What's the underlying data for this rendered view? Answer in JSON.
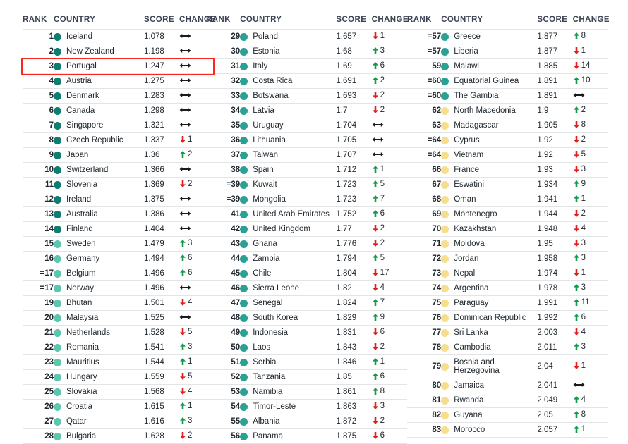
{
  "headers": {
    "rank": "RANK",
    "country": "COUNTRY",
    "score": "SCORE",
    "change": "CHANGE"
  },
  "colors": {
    "dot_dark_teal": "#0f7d72",
    "dot_mid_teal": "#2aa193",
    "dot_light_teal": "#5ec6ae",
    "dot_yellow": "#f7dd8e",
    "up_green": "#159a4b",
    "down_red": "#e02020",
    "flat_black": "#1a1a1a",
    "highlight_border": "#f8281e",
    "row_border": "#e2e4e6",
    "header_text": "#3c4352"
  },
  "highlight": {
    "column": 0,
    "row_rank": "3",
    "country": "Portugal"
  },
  "columns": [
    {
      "id": "column-1",
      "rows": [
        {
          "rank": "1",
          "country": "Iceland",
          "score": "1.078",
          "change": "0",
          "dot": "dot_dark_teal"
        },
        {
          "rank": "2",
          "country": "New Zealand",
          "score": "1.198",
          "change": "0",
          "dot": "dot_dark_teal"
        },
        {
          "rank": "3",
          "country": "Portugal",
          "score": "1.247",
          "change": "0",
          "dot": "dot_dark_teal"
        },
        {
          "rank": "4",
          "country": "Austria",
          "score": "1.275",
          "change": "0",
          "dot": "dot_dark_teal"
        },
        {
          "rank": "5",
          "country": "Denmark",
          "score": "1.283",
          "change": "0",
          "dot": "dot_dark_teal"
        },
        {
          "rank": "6",
          "country": "Canada",
          "score": "1.298",
          "change": "0",
          "dot": "dot_dark_teal"
        },
        {
          "rank": "7",
          "country": "Singapore",
          "score": "1.321",
          "change": "0",
          "dot": "dot_dark_teal"
        },
        {
          "rank": "8",
          "country": "Czech Republic",
          "score": "1.337",
          "change": "-1",
          "dot": "dot_dark_teal"
        },
        {
          "rank": "9",
          "country": "Japan",
          "score": "1.36",
          "change": "+2",
          "dot": "dot_dark_teal"
        },
        {
          "rank": "10",
          "country": "Switzerland",
          "score": "1.366",
          "change": "0",
          "dot": "dot_dark_teal"
        },
        {
          "rank": "11",
          "country": "Slovenia",
          "score": "1.369",
          "change": "-2",
          "dot": "dot_dark_teal"
        },
        {
          "rank": "12",
          "country": "Ireland",
          "score": "1.375",
          "change": "0",
          "dot": "dot_dark_teal"
        },
        {
          "rank": "13",
          "country": "Australia",
          "score": "1.386",
          "change": "0",
          "dot": "dot_dark_teal"
        },
        {
          "rank": "14",
          "country": "Finland",
          "score": "1.404",
          "change": "0",
          "dot": "dot_dark_teal"
        },
        {
          "rank": "15",
          "country": "Sweden",
          "score": "1.479",
          "change": "+3",
          "dot": "dot_light_teal"
        },
        {
          "rank": "16",
          "country": "Germany",
          "score": "1.494",
          "change": "+6",
          "dot": "dot_light_teal"
        },
        {
          "rank": "=17",
          "country": "Belgium",
          "score": "1.496",
          "change": "+6",
          "dot": "dot_light_teal"
        },
        {
          "rank": "=17",
          "country": "Norway",
          "score": "1.496",
          "change": "0",
          "dot": "dot_light_teal"
        },
        {
          "rank": "19",
          "country": "Bhutan",
          "score": "1.501",
          "change": "-4",
          "dot": "dot_light_teal"
        },
        {
          "rank": "20",
          "country": "Malaysia",
          "score": "1.525",
          "change": "0",
          "dot": "dot_light_teal"
        },
        {
          "rank": "21",
          "country": "Netherlands",
          "score": "1.528",
          "change": "-5",
          "dot": "dot_light_teal"
        },
        {
          "rank": "22",
          "country": "Romania",
          "score": "1.541",
          "change": "+3",
          "dot": "dot_light_teal"
        },
        {
          "rank": "23",
          "country": "Mauritius",
          "score": "1.544",
          "change": "+1",
          "dot": "dot_light_teal"
        },
        {
          "rank": "24",
          "country": "Hungary",
          "score": "1.559",
          "change": "-5",
          "dot": "dot_light_teal"
        },
        {
          "rank": "25",
          "country": "Slovakia",
          "score": "1.568",
          "change": "-4",
          "dot": "dot_light_teal"
        },
        {
          "rank": "26",
          "country": "Croatia",
          "score": "1.615",
          "change": "+1",
          "dot": "dot_light_teal"
        },
        {
          "rank": "27",
          "country": "Qatar",
          "score": "1.616",
          "change": "+3",
          "dot": "dot_light_teal"
        },
        {
          "rank": "28",
          "country": "Bulgaria",
          "score": "1.628",
          "change": "-2",
          "dot": "dot_light_teal"
        }
      ]
    },
    {
      "id": "column-2",
      "rows": [
        {
          "rank": "29",
          "country": "Poland",
          "score": "1.657",
          "change": "-1",
          "dot": "dot_mid_teal"
        },
        {
          "rank": "30",
          "country": "Estonia",
          "score": "1.68",
          "change": "+3",
          "dot": "dot_mid_teal"
        },
        {
          "rank": "31",
          "country": "Italy",
          "score": "1.69",
          "change": "+6",
          "dot": "dot_mid_teal"
        },
        {
          "rank": "32",
          "country": "Costa Rica",
          "score": "1.691",
          "change": "+2",
          "dot": "dot_mid_teal"
        },
        {
          "rank": "33",
          "country": "Botswana",
          "score": "1.693",
          "change": "-2",
          "dot": "dot_mid_teal"
        },
        {
          "rank": "34",
          "country": "Latvia",
          "score": "1.7",
          "change": "-2",
          "dot": "dot_mid_teal"
        },
        {
          "rank": "35",
          "country": "Uruguay",
          "score": "1.704",
          "change": "0",
          "dot": "dot_mid_teal"
        },
        {
          "rank": "36",
          "country": "Lithuania",
          "score": "1.705",
          "change": "0",
          "dot": "dot_mid_teal"
        },
        {
          "rank": "37",
          "country": "Taiwan",
          "score": "1.707",
          "change": "0",
          "dot": "dot_mid_teal"
        },
        {
          "rank": "38",
          "country": "Spain",
          "score": "1.712",
          "change": "+1",
          "dot": "dot_mid_teal"
        },
        {
          "rank": "=39",
          "country": "Kuwait",
          "score": "1.723",
          "change": "+5",
          "dot": "dot_mid_teal"
        },
        {
          "rank": "=39",
          "country": "Mongolia",
          "score": "1.723",
          "change": "+7",
          "dot": "dot_mid_teal"
        },
        {
          "rank": "41",
          "country": "United Arab Emirates",
          "score": "1.752",
          "change": "+6",
          "dot": "dot_mid_teal"
        },
        {
          "rank": "42",
          "country": "United Kingdom",
          "score": "1.77",
          "change": "-2",
          "dot": "dot_mid_teal"
        },
        {
          "rank": "43",
          "country": "Ghana",
          "score": "1.776",
          "change": "-2",
          "dot": "dot_mid_teal"
        },
        {
          "rank": "44",
          "country": "Zambia",
          "score": "1.794",
          "change": "+5",
          "dot": "dot_mid_teal"
        },
        {
          "rank": "45",
          "country": "Chile",
          "score": "1.804",
          "change": "-17",
          "dot": "dot_mid_teal"
        },
        {
          "rank": "46",
          "country": "Sierra Leone",
          "score": "1.82",
          "change": "-4",
          "dot": "dot_mid_teal"
        },
        {
          "rank": "47",
          "country": "Senegal",
          "score": "1.824",
          "change": "+7",
          "dot": "dot_mid_teal"
        },
        {
          "rank": "48",
          "country": "South Korea",
          "score": "1.829",
          "change": "+9",
          "dot": "dot_mid_teal"
        },
        {
          "rank": "49",
          "country": "Indonesia",
          "score": "1.831",
          "change": "-6",
          "dot": "dot_mid_teal"
        },
        {
          "rank": "50",
          "country": "Laos",
          "score": "1.843",
          "change": "-2",
          "dot": "dot_mid_teal"
        },
        {
          "rank": "51",
          "country": "Serbia",
          "score": "1.846",
          "change": "+1",
          "dot": "dot_mid_teal"
        },
        {
          "rank": "52",
          "country": "Tanzania",
          "score": "1.85",
          "change": "+6",
          "dot": "dot_mid_teal"
        },
        {
          "rank": "53",
          "country": "Namibia",
          "score": "1.861",
          "change": "+8",
          "dot": "dot_mid_teal"
        },
        {
          "rank": "54",
          "country": "Timor-Leste",
          "score": "1.863",
          "change": "-3",
          "dot": "dot_mid_teal"
        },
        {
          "rank": "55",
          "country": "Albania",
          "score": "1.872",
          "change": "-2",
          "dot": "dot_mid_teal"
        },
        {
          "rank": "56",
          "country": "Panama",
          "score": "1.875",
          "change": "-6",
          "dot": "dot_mid_teal"
        }
      ]
    },
    {
      "id": "column-3",
      "rows": [
        {
          "rank": "=57",
          "country": "Greece",
          "score": "1.877",
          "change": "+8",
          "dot": "dot_mid_teal"
        },
        {
          "rank": "=57",
          "country": "Liberia",
          "score": "1.877",
          "change": "-1",
          "dot": "dot_mid_teal"
        },
        {
          "rank": "59",
          "country": "Malawi",
          "score": "1.885",
          "change": "-14",
          "dot": "dot_mid_teal"
        },
        {
          "rank": "=60",
          "country": "Equatorial Guinea",
          "score": "1.891",
          "change": "+10",
          "dot": "dot_mid_teal"
        },
        {
          "rank": "=60",
          "country": "The Gambia",
          "score": "1.891",
          "change": "0",
          "dot": "dot_mid_teal"
        },
        {
          "rank": "62",
          "country": "North Macedonia",
          "score": "1.9",
          "change": "+2",
          "dot": "dot_yellow"
        },
        {
          "rank": "63",
          "country": "Madagascar",
          "score": "1.905",
          "change": "-8",
          "dot": "dot_yellow"
        },
        {
          "rank": "=64",
          "country": "Cyprus",
          "score": "1.92",
          "change": "-2",
          "dot": "dot_yellow"
        },
        {
          "rank": "=64",
          "country": "Vietnam",
          "score": "1.92",
          "change": "-5",
          "dot": "dot_yellow"
        },
        {
          "rank": "66",
          "country": "France",
          "score": "1.93",
          "change": "-3",
          "dot": "dot_yellow"
        },
        {
          "rank": "67",
          "country": "Eswatini",
          "score": "1.934",
          "change": "+9",
          "dot": "dot_yellow"
        },
        {
          "rank": "68",
          "country": "Oman",
          "score": "1.941",
          "change": "+1",
          "dot": "dot_yellow"
        },
        {
          "rank": "69",
          "country": "Montenegro",
          "score": "1.944",
          "change": "-2",
          "dot": "dot_yellow"
        },
        {
          "rank": "70",
          "country": "Kazakhstan",
          "score": "1.948",
          "change": "-4",
          "dot": "dot_yellow"
        },
        {
          "rank": "71",
          "country": "Moldova",
          "score": "1.95",
          "change": "-3",
          "dot": "dot_yellow"
        },
        {
          "rank": "72",
          "country": "Jordan",
          "score": "1.958",
          "change": "+3",
          "dot": "dot_yellow"
        },
        {
          "rank": "73",
          "country": "Nepal",
          "score": "1.974",
          "change": "-1",
          "dot": "dot_yellow"
        },
        {
          "rank": "74",
          "country": "Argentina",
          "score": "1.978",
          "change": "+3",
          "dot": "dot_yellow"
        },
        {
          "rank": "75",
          "country": "Paraguay",
          "score": "1.991",
          "change": "+11",
          "dot": "dot_yellow"
        },
        {
          "rank": "76",
          "country": "Dominican Republic",
          "score": "1.992",
          "change": "+6",
          "dot": "dot_yellow"
        },
        {
          "rank": "77",
          "country": "Sri Lanka",
          "score": "2.003",
          "change": "-4",
          "dot": "dot_yellow"
        },
        {
          "rank": "78",
          "country": "Cambodia",
          "score": "2.011",
          "change": "+3",
          "dot": "dot_yellow"
        },
        {
          "rank": "79",
          "country": "Bosnia and Herzegovina",
          "score": "2.04",
          "change": "-1",
          "dot": "dot_yellow",
          "tall": true
        },
        {
          "rank": "80",
          "country": "Jamaica",
          "score": "2.041",
          "change": "0",
          "dot": "dot_yellow"
        },
        {
          "rank": "81",
          "country": "Rwanda",
          "score": "2.049",
          "change": "+4",
          "dot": "dot_yellow"
        },
        {
          "rank": "82",
          "country": "Guyana",
          "score": "2.05",
          "change": "+8",
          "dot": "dot_yellow"
        },
        {
          "rank": "83",
          "country": "Morocco",
          "score": "2.057",
          "change": "+1",
          "dot": "dot_yellow"
        }
      ]
    }
  ]
}
